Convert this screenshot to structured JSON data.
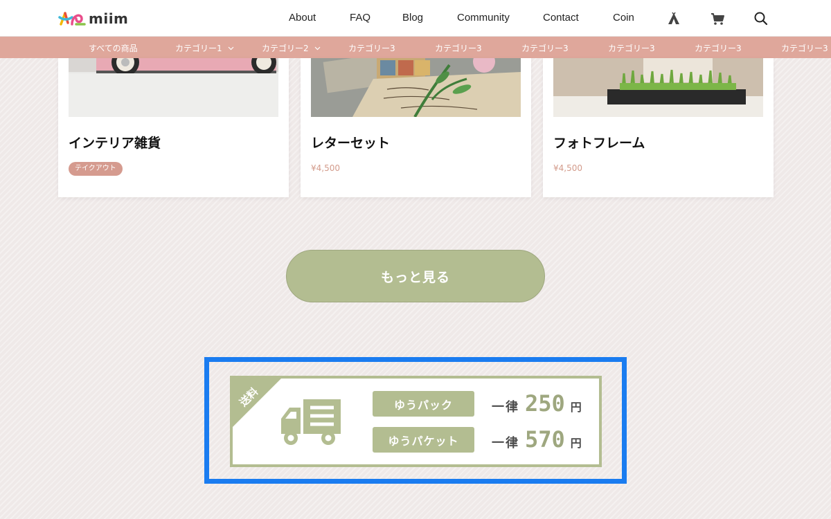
{
  "brand": {
    "name": "miim"
  },
  "nav": {
    "links": [
      "About",
      "FAQ",
      "Blog",
      "Community",
      "Contact",
      "Coin"
    ],
    "icons": [
      "tent-icon",
      "cart-icon",
      "search-icon"
    ]
  },
  "categories": {
    "items": [
      {
        "label": "すべての商品",
        "dropdown": false
      },
      {
        "label": "カテゴリー1",
        "dropdown": true
      },
      {
        "label": "カテゴリー2",
        "dropdown": true
      },
      {
        "label": "カテゴリー3",
        "dropdown": false
      },
      {
        "label": "カテゴリー3",
        "dropdown": false
      },
      {
        "label": "カテゴリー3",
        "dropdown": false
      },
      {
        "label": "カテゴリー3",
        "dropdown": false
      },
      {
        "label": "カテゴリー3",
        "dropdown": false
      },
      {
        "label": "カテゴリー3",
        "dropdown": false
      }
    ]
  },
  "products": [
    {
      "title": "インテリア雑貨",
      "badge": "テイクアウト",
      "price": ""
    },
    {
      "title": "レターセット",
      "badge": "",
      "price": "¥4,500"
    },
    {
      "title": "フォトフレーム",
      "badge": "",
      "price": "¥4,500"
    }
  ],
  "more_button": {
    "label": "もっと見る"
  },
  "shipping": {
    "ribbon": "送料",
    "rows": [
      {
        "service": "ゆうパック",
        "prefix": "一律",
        "amount": "250",
        "unit": "円"
      },
      {
        "service": "ゆうパケット",
        "prefix": "一律",
        "amount": "570",
        "unit": "円"
      }
    ]
  },
  "colors": {
    "accent_green": "#b3bd91",
    "category_bar": "#dfa79b",
    "highlight": "#1a7cf0",
    "price": "#d39b8b"
  }
}
